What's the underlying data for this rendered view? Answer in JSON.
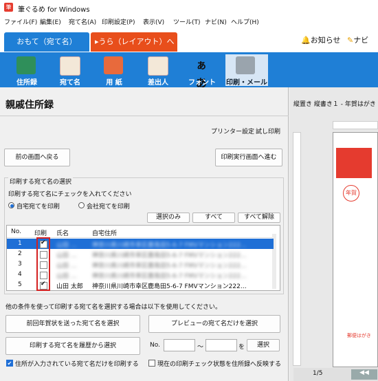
{
  "window": {
    "title": "筆ぐるめ for Windows"
  },
  "menu": [
    "ファイル(F)",
    "編集(E)",
    "宛て名(A)",
    "印刷設定(P)",
    "表示(V)",
    "ツール(T)",
    "ナビ(N)",
    "ヘルプ(H)"
  ],
  "mode_tabs": {
    "front": "おもて（宛て名）",
    "back": "▸うら（レイアウト）へ切替"
  },
  "top_links": {
    "news": "お知らせ",
    "navi": "ナビ"
  },
  "toolbar": [
    "住所録",
    "宛て名",
    "用 紙",
    "差出人",
    "フォント",
    "印刷・メール"
  ],
  "toolbar_active": "印刷・メール",
  "font_tool_glyph": "ぁあ",
  "heading": "親戚住所録",
  "links": {
    "printer": "プリンター設定",
    "test_print": "試し印刷"
  },
  "buttons": {
    "back": "前の画面へ戻る",
    "next": "印刷実行画面へ進む"
  },
  "group": {
    "title": "印刷する宛て名の選択",
    "instruction": "印刷する宛て名にチェックを入れてください",
    "radio_home": "自宅宛てを印刷",
    "radio_company": "会社宛てを印刷",
    "select_only": "選択のみ",
    "select_all": "すべて",
    "clear_all": "すべて解除"
  },
  "table": {
    "headers": [
      "No.",
      "印刷",
      "氏名",
      "自宅住所"
    ],
    "rows": [
      {
        "no": "1",
        "checked": true,
        "name": "山田 …",
        "addr": "神奈川県川崎市幸区鹿島田5-6-7 FMVマンション222…",
        "blur_name": true,
        "blur_addr": true,
        "selected": true
      },
      {
        "no": "2",
        "checked": false,
        "name": "山田 …",
        "addr": "神奈川県川崎市幸区鹿島田5-6-7 FMVマンション222…",
        "blur_name": true,
        "blur_addr": true,
        "selected": false
      },
      {
        "no": "3",
        "checked": false,
        "name": "山田 …",
        "addr": "神奈川県川崎市幸区鹿島田5-6-7 FMVマンション222…",
        "blur_name": true,
        "blur_addr": true,
        "selected": false
      },
      {
        "no": "4",
        "checked": false,
        "name": "山田 …",
        "addr": "神奈川県川崎市幸区鹿島田5-6-7 FMVマンション222…",
        "blur_name": true,
        "blur_addr": true,
        "selected": false
      },
      {
        "no": "5",
        "checked": true,
        "name": "山田 太郎",
        "addr": "神奈川県川崎市幸区鹿島田5-6-7 FMVマンション222…",
        "blur_name": false,
        "blur_addr": false,
        "selected": false
      }
    ]
  },
  "other": {
    "note": "他の条件を使って印刷する宛て名を選択する場合は以下を使用してください。",
    "prev_year": "前回年賀状を送った宛て名を選択",
    "preview_only": "プレビューの宛て名だけを選択",
    "history": "印刷する宛て名を履歴から選択",
    "no_label": "No.",
    "tilde": "～",
    "wo": "を",
    "select_btn": "選択",
    "cb_address_only": "住所が入力されている宛て名だけを印刷する",
    "cb_reflect": "現在の印刷チェック状態を住所録へ反映する"
  },
  "preview": {
    "title": "縦置き 縦書き１ - 年賀はがき",
    "page": "1/5",
    "postcard_text": [
      "年賀",
      "郵便はがき"
    ]
  },
  "colors": {
    "accent": "#1f7fd6",
    "orange": "#e84e1b",
    "highlight": "#1f6fd6",
    "red_box": "#d42020"
  }
}
